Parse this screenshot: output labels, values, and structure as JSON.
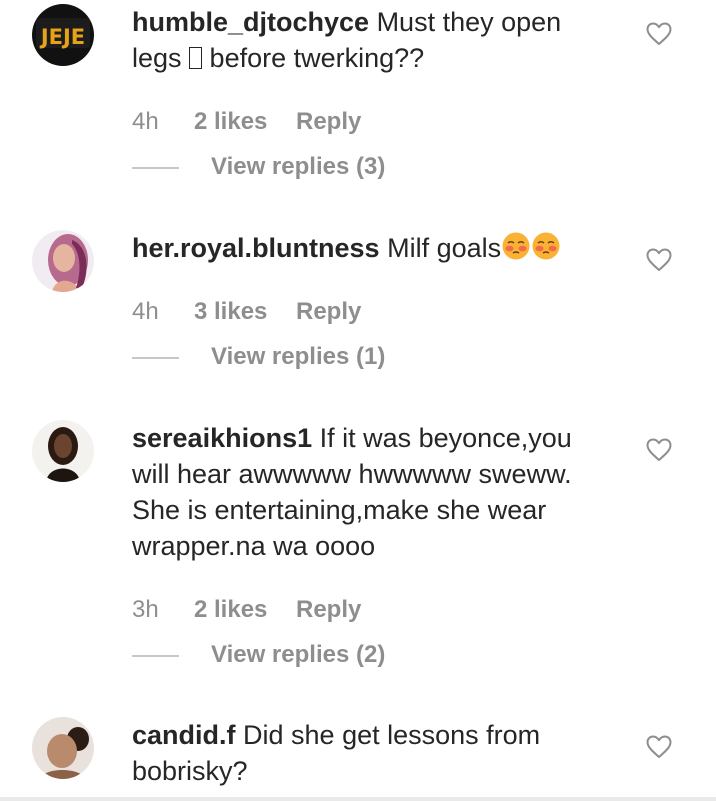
{
  "colors": {
    "text": "#262626",
    "secondary": "#8e8e8e",
    "divider": "#c7c7c7"
  },
  "comments": [
    {
      "username": "humble_djtochyce",
      "text_before_glyph": " Must they open legs ",
      "text_after_glyph": " before twerking??",
      "time": "4h",
      "likes": "2 likes",
      "reply": "Reply",
      "view_replies": "View replies (3)",
      "avatar_text": "JEJE",
      "icon": "heart-outline-icon"
    },
    {
      "username": "her.royal.bluntness",
      "text": " Milf goals",
      "emoji": "flushed-face-emoji",
      "time": "4h",
      "likes": "3 likes",
      "reply": "Reply",
      "view_replies": "View replies (1)",
      "icon": "heart-outline-icon"
    },
    {
      "username": "sereaikhions1",
      "text": " If it was beyonce,you will hear awwwww hwwwww sweww. She is entertaining,make she wear wrapper.na wa oooo",
      "time": "3h",
      "likes": "2 likes",
      "reply": "Reply",
      "view_replies": "View replies (2)",
      "icon": "heart-outline-icon"
    },
    {
      "username": "candid.f",
      "text": " Did she get lessons from bobrisky?",
      "icon": "heart-outline-icon"
    }
  ]
}
